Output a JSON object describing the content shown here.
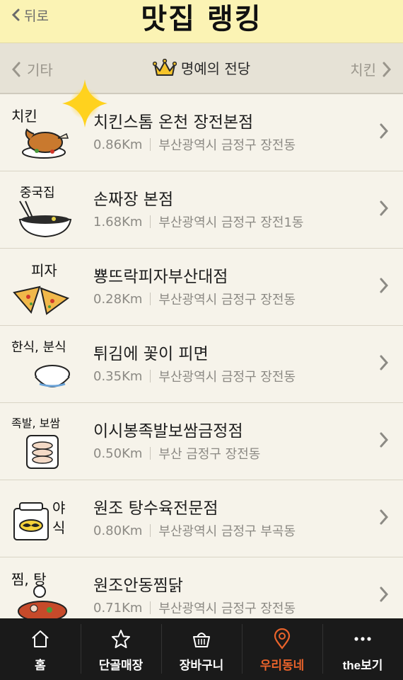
{
  "header": {
    "back_label": "뒤로",
    "title": "맛집 랭킹"
  },
  "category_bar": {
    "prev_label": "기타",
    "current_label": "명예의 전당",
    "next_label": "치킨"
  },
  "colors": {
    "header_bg": "#fbf3b4",
    "active_tab": "#e9632b",
    "tabbar_bg": "#1a1a1a"
  },
  "restaurants": [
    {
      "category_icon": "chicken",
      "category_text": "치킨",
      "name": "치킨스톰 온천 장전본점",
      "distance": "0.86Km",
      "address": "부산광역시 금정구 장전동"
    },
    {
      "category_icon": "chinese",
      "category_text": "중국집",
      "name": "손짜장 본점",
      "distance": "1.68Km",
      "address": "부산광역시 금정구 장전1동"
    },
    {
      "category_icon": "pizza",
      "category_text": "피자",
      "name": "뿅뜨락피자부산대점",
      "distance": "0.28Km",
      "address": "부산광역시 금정구 장전동"
    },
    {
      "category_icon": "korean",
      "category_text": "한식, 분식",
      "name": "튀김에 꽃이 피면",
      "distance": "0.35Km",
      "address": "부산광역시 금정구 장전동"
    },
    {
      "category_icon": "jokbal",
      "category_text": "족발, 보쌈",
      "name": "이시봉족발보쌈금정점",
      "distance": "0.50Km",
      "address": "부산 금정구 장전동"
    },
    {
      "category_icon": "latenight",
      "category_text": "야식",
      "name": "원조 탕수육전문점",
      "distance": "0.80Km",
      "address": "부산광역시 금정구 부곡동"
    },
    {
      "category_icon": "stew",
      "category_text": "찜, 탕",
      "name": "원조안동찜닭",
      "distance": "0.71Km",
      "address": "부산광역시 금정구 장전동"
    }
  ],
  "tabs": [
    {
      "label": "홈",
      "icon": "home-icon"
    },
    {
      "label": "단골매장",
      "icon": "star-icon"
    },
    {
      "label": "장바구니",
      "icon": "basket-icon"
    },
    {
      "label": "우리동네",
      "icon": "location-pin-icon",
      "active": true
    },
    {
      "label": "the보기",
      "icon": "more-dots-icon"
    }
  ]
}
